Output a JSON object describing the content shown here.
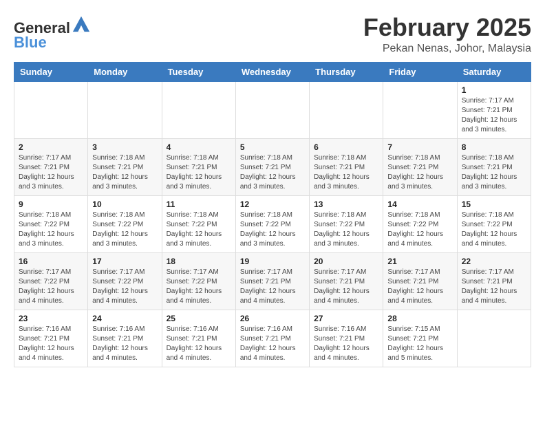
{
  "header": {
    "logo_general": "General",
    "logo_blue": "Blue",
    "month_year": "February 2025",
    "location": "Pekan Nenas, Johor, Malaysia"
  },
  "weekdays": [
    "Sunday",
    "Monday",
    "Tuesday",
    "Wednesday",
    "Thursday",
    "Friday",
    "Saturday"
  ],
  "weeks": [
    [
      {
        "day": "",
        "detail": ""
      },
      {
        "day": "",
        "detail": ""
      },
      {
        "day": "",
        "detail": ""
      },
      {
        "day": "",
        "detail": ""
      },
      {
        "day": "",
        "detail": ""
      },
      {
        "day": "",
        "detail": ""
      },
      {
        "day": "1",
        "detail": "Sunrise: 7:17 AM\nSunset: 7:21 PM\nDaylight: 12 hours\nand 3 minutes."
      }
    ],
    [
      {
        "day": "2",
        "detail": "Sunrise: 7:17 AM\nSunset: 7:21 PM\nDaylight: 12 hours\nand 3 minutes."
      },
      {
        "day": "3",
        "detail": "Sunrise: 7:18 AM\nSunset: 7:21 PM\nDaylight: 12 hours\nand 3 minutes."
      },
      {
        "day": "4",
        "detail": "Sunrise: 7:18 AM\nSunset: 7:21 PM\nDaylight: 12 hours\nand 3 minutes."
      },
      {
        "day": "5",
        "detail": "Sunrise: 7:18 AM\nSunset: 7:21 PM\nDaylight: 12 hours\nand 3 minutes."
      },
      {
        "day": "6",
        "detail": "Sunrise: 7:18 AM\nSunset: 7:21 PM\nDaylight: 12 hours\nand 3 minutes."
      },
      {
        "day": "7",
        "detail": "Sunrise: 7:18 AM\nSunset: 7:21 PM\nDaylight: 12 hours\nand 3 minutes."
      },
      {
        "day": "8",
        "detail": "Sunrise: 7:18 AM\nSunset: 7:21 PM\nDaylight: 12 hours\nand 3 minutes."
      }
    ],
    [
      {
        "day": "9",
        "detail": "Sunrise: 7:18 AM\nSunset: 7:22 PM\nDaylight: 12 hours\nand 3 minutes."
      },
      {
        "day": "10",
        "detail": "Sunrise: 7:18 AM\nSunset: 7:22 PM\nDaylight: 12 hours\nand 3 minutes."
      },
      {
        "day": "11",
        "detail": "Sunrise: 7:18 AM\nSunset: 7:22 PM\nDaylight: 12 hours\nand 3 minutes."
      },
      {
        "day": "12",
        "detail": "Sunrise: 7:18 AM\nSunset: 7:22 PM\nDaylight: 12 hours\nand 3 minutes."
      },
      {
        "day": "13",
        "detail": "Sunrise: 7:18 AM\nSunset: 7:22 PM\nDaylight: 12 hours\nand 3 minutes."
      },
      {
        "day": "14",
        "detail": "Sunrise: 7:18 AM\nSunset: 7:22 PM\nDaylight: 12 hours\nand 4 minutes."
      },
      {
        "day": "15",
        "detail": "Sunrise: 7:18 AM\nSunset: 7:22 PM\nDaylight: 12 hours\nand 4 minutes."
      }
    ],
    [
      {
        "day": "16",
        "detail": "Sunrise: 7:17 AM\nSunset: 7:22 PM\nDaylight: 12 hours\nand 4 minutes."
      },
      {
        "day": "17",
        "detail": "Sunrise: 7:17 AM\nSunset: 7:22 PM\nDaylight: 12 hours\nand 4 minutes."
      },
      {
        "day": "18",
        "detail": "Sunrise: 7:17 AM\nSunset: 7:22 PM\nDaylight: 12 hours\nand 4 minutes."
      },
      {
        "day": "19",
        "detail": "Sunrise: 7:17 AM\nSunset: 7:21 PM\nDaylight: 12 hours\nand 4 minutes."
      },
      {
        "day": "20",
        "detail": "Sunrise: 7:17 AM\nSunset: 7:21 PM\nDaylight: 12 hours\nand 4 minutes."
      },
      {
        "day": "21",
        "detail": "Sunrise: 7:17 AM\nSunset: 7:21 PM\nDaylight: 12 hours\nand 4 minutes."
      },
      {
        "day": "22",
        "detail": "Sunrise: 7:17 AM\nSunset: 7:21 PM\nDaylight: 12 hours\nand 4 minutes."
      }
    ],
    [
      {
        "day": "23",
        "detail": "Sunrise: 7:16 AM\nSunset: 7:21 PM\nDaylight: 12 hours\nand 4 minutes."
      },
      {
        "day": "24",
        "detail": "Sunrise: 7:16 AM\nSunset: 7:21 PM\nDaylight: 12 hours\nand 4 minutes."
      },
      {
        "day": "25",
        "detail": "Sunrise: 7:16 AM\nSunset: 7:21 PM\nDaylight: 12 hours\nand 4 minutes."
      },
      {
        "day": "26",
        "detail": "Sunrise: 7:16 AM\nSunset: 7:21 PM\nDaylight: 12 hours\nand 4 minutes."
      },
      {
        "day": "27",
        "detail": "Sunrise: 7:16 AM\nSunset: 7:21 PM\nDaylight: 12 hours\nand 4 minutes."
      },
      {
        "day": "28",
        "detail": "Sunrise: 7:15 AM\nSunset: 7:21 PM\nDaylight: 12 hours\nand 5 minutes."
      },
      {
        "day": "",
        "detail": ""
      }
    ]
  ]
}
